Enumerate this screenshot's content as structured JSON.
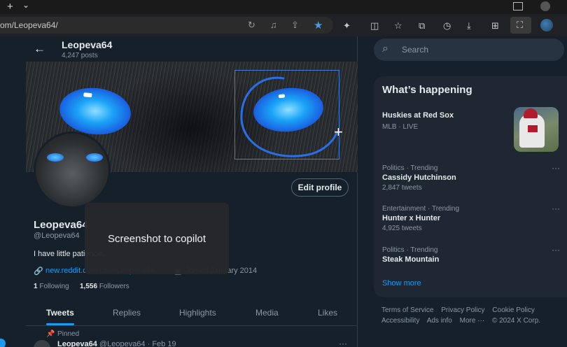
{
  "browser": {
    "tabstrip": {
      "new_tab": "+",
      "dropdown": "⌄"
    },
    "address": {
      "url": "om/Leopeva64/"
    },
    "colors": {
      "accent": "#1d9bf0",
      "favorite_star": "#4c9ce6"
    }
  },
  "profile_header": {
    "name": "Leopeva64",
    "posts": "4,247 posts"
  },
  "profile": {
    "edit_button": "Edit profile",
    "display_name": "Leopeva64",
    "handle": "@Leopeva64",
    "bio": "I have little patience...",
    "link": "new.reddit.com/user/Leopeva64...",
    "joined": "Joined January 2014",
    "following_count": "1",
    "following_label": "Following",
    "followers_count": "1,556",
    "followers_label": "Followers"
  },
  "toast": {
    "text": "Screenshot to copilot"
  },
  "tabs": [
    {
      "label": "Tweets"
    },
    {
      "label": "Replies"
    },
    {
      "label": "Highlights"
    },
    {
      "label": "Media"
    },
    {
      "label": "Likes"
    }
  ],
  "pinned_tweet": {
    "pinned_label": "Pinned",
    "author": "Leopeva64",
    "handle": "@Leopeva64",
    "date": "· Feb 19"
  },
  "search": {
    "placeholder": "Search"
  },
  "trends": {
    "title": "What’s happening",
    "items": [
      {
        "category": "MLB · LIVE",
        "title": "Huskies at Red Sox",
        "count": ""
      },
      {
        "category": "Politics · Trending",
        "title": "Cassidy Hutchinson",
        "count": "2,847 tweets"
      },
      {
        "category": "Entertainment · Trending",
        "title": "Hunter x Hunter",
        "count": "4,925 tweets"
      },
      {
        "category": "Politics · Trending",
        "title": "Steak Mountain",
        "count": ""
      }
    ],
    "show_more": "Show more"
  },
  "footer": {
    "links": [
      "Terms of Service",
      "Privacy Policy",
      "Cookie Policy",
      "Accessibility",
      "Ads info",
      "More ···",
      "© 2024 X Corp."
    ]
  }
}
